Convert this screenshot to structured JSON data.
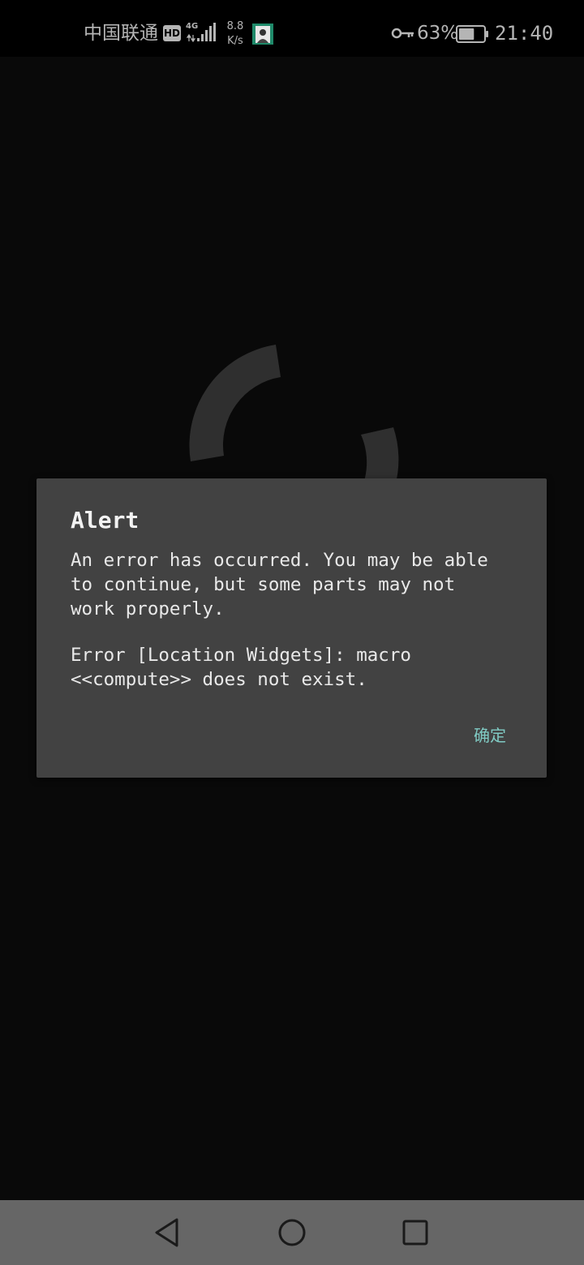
{
  "status_bar": {
    "carrier": "中国联通",
    "hd": "HD",
    "network_type": "4G",
    "speed_value": "8.8",
    "speed_unit": "K/s",
    "battery_percent": "63%",
    "battery_level": 0.63,
    "time": "21:40",
    "icons": [
      "signal-icon",
      "app-notification-icon",
      "vpn-key-icon",
      "battery-icon"
    ]
  },
  "dialog": {
    "title": "Alert",
    "message": "An error has occurred. You may be able\nto continue, but some parts may not\nwork properly.",
    "error": "Error [Location Widgets]: macro\n<<compute>> does not exist.",
    "ok_label": "确定"
  },
  "nav_bar": {
    "icons": [
      "back-icon",
      "home-icon",
      "recent-apps-icon"
    ]
  },
  "colors": {
    "background": "#090909",
    "dialog_bg": "#424242",
    "accent": "#80cbc4",
    "status_text": "#b5b5b5",
    "nav_bar": "#666666",
    "spinner": "#2f2f2f"
  }
}
